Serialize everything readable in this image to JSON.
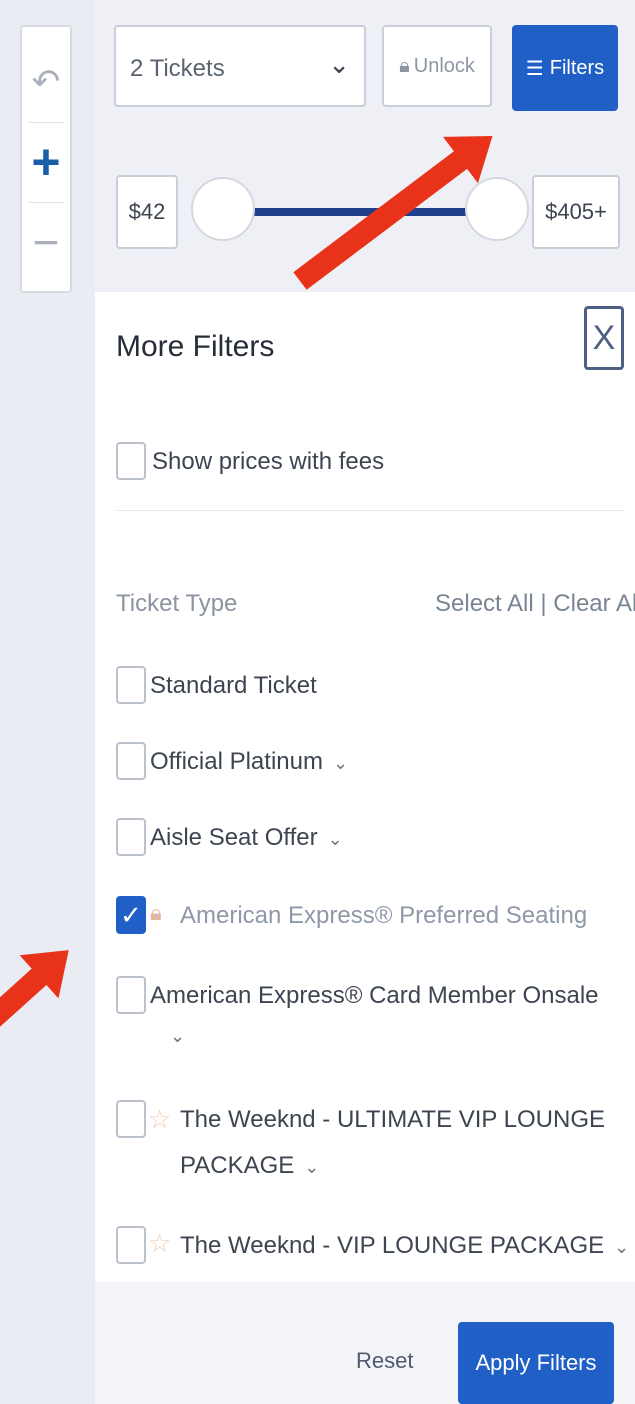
{
  "map_controls": {
    "undo_icon": "undo-icon",
    "zoom_in_icon": "plus-icon",
    "zoom_out_icon": "minus-icon"
  },
  "toolbar": {
    "quantity_value": "2 Tickets",
    "unlock_label": "Unlock",
    "filters_label": "Filters"
  },
  "price_range": {
    "min_label": "$42",
    "max_label": "$405+"
  },
  "more_filters": {
    "title": "More Filters",
    "close_label": "X",
    "show_fees_label": "Show prices with fees",
    "ticket_type_title": "Ticket Type",
    "select_all_label": "Select All",
    "separator": "|",
    "clear_all_label": "Clear All",
    "items": [
      {
        "label": "Standard Ticket",
        "checked": false
      },
      {
        "label": "Official Platinum",
        "checked": false
      },
      {
        "label": "Aisle Seat Offer",
        "checked": false
      },
      {
        "label": "American Express® Preferred Seating",
        "checked": true
      },
      {
        "label": "American Express® Card Member Onsale",
        "checked": false
      },
      {
        "label_line1": "The Weeknd - ULTIMATE VIP LOUNGE",
        "label_line2": "PACKAGE",
        "checked": false
      },
      {
        "label": "The Weeknd - VIP LOUNGE PACKAGE",
        "checked": false
      }
    ]
  },
  "footer": {
    "reset_label": "Reset",
    "apply_label": "Apply Filters"
  },
  "colors": {
    "primary": "#1f5fc6",
    "annotation_arrow": "#e8321a"
  }
}
